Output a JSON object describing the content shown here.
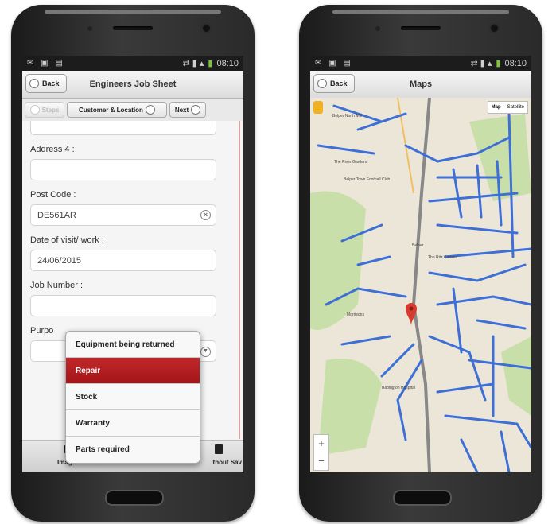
{
  "left_phone": {
    "status": {
      "left_icons": "✉ ▣ ▤",
      "right_icons": "⇄ ▮ ▴",
      "time": "08:10"
    },
    "header": {
      "back_label": "Back",
      "title": "Engineers Job Sheet"
    },
    "wizard": {
      "prev_label": "Steps",
      "current_label": "Customer & Location",
      "next_label": "Next"
    },
    "form": {
      "address4_label": "Address 4 :",
      "address4_value": "",
      "postcode_label": "Post Code :",
      "postcode_value": "DE561AR",
      "date_label": "Date of visit/ work :",
      "date_value": "24/06/2015",
      "jobnumber_label": "Job Number :",
      "purpose_label": "Purpo"
    },
    "popup_options": [
      "Equipment being returned",
      "Repair",
      "Stock",
      "Warranty",
      "Parts required"
    ],
    "popup_selected": "Repair",
    "footer": {
      "left_label": "Imag",
      "right_label": "thout Sav"
    }
  },
  "right_phone": {
    "status": {
      "left_icons": "✉ ▣ ▤",
      "right_icons": "⇄ ▮ ▴",
      "time": "08:10"
    },
    "header": {
      "back_label": "Back",
      "title": "Maps"
    },
    "map": {
      "type_map": "Map",
      "type_satellite": "Satellite",
      "zoom_in": "+",
      "zoom_out": "−",
      "labels": [
        "Belper North Mill",
        "The River Gardens",
        "Belper Town Football Club",
        "Belper",
        "The Ritz Cinema",
        "Morrisons",
        "Babington Hospital"
      ]
    }
  },
  "colors": {
    "accent_red": "#b01d20",
    "road_blue": "#3d6fd6",
    "map_bg": "#ece6d8",
    "park_green": "#c9dfa9"
  }
}
